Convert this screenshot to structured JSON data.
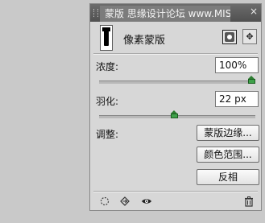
{
  "panel": {
    "tab_title": "蒙版",
    "watermark": "思缘设计论坛 www.MISSYUAN.com",
    "close_glyph": "×"
  },
  "mask": {
    "title": "像素蒙版",
    "vector_glyph": "✥"
  },
  "density": {
    "label": "浓度:",
    "value": "100%",
    "level_percent": 100
  },
  "feather": {
    "label": "羽化:",
    "value": "22 px",
    "level_percent": 48
  },
  "refine": {
    "label": "调整:",
    "buttons": [
      "蒙版边缘...",
      "颜色范围...",
      "反相"
    ]
  },
  "bottom_icons": [
    "load-selection-icon",
    "apply-mask-icon",
    "visibility-eye-icon",
    "delete-mask-icon"
  ]
}
